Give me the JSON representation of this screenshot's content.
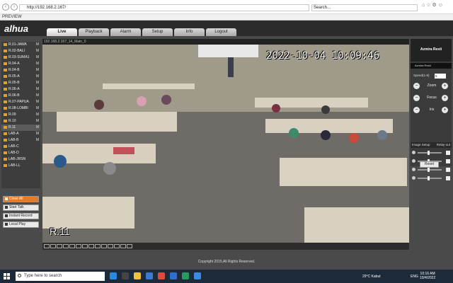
{
  "browser": {
    "url": "http://192.168.2.167/",
    "search_placeholder": "Search...",
    "tab_title": "PREVIEW"
  },
  "app": {
    "logo": "alhua",
    "nav_tabs": [
      "Live",
      "Playback",
      "Alarm",
      "Setup",
      "Info",
      "Logout"
    ],
    "active_tab": "Live"
  },
  "sidebar": {
    "cameras": [
      {
        "label": "R.01-JAWA",
        "flag": "M"
      },
      {
        "label": "R.02-BALI",
        "flag": "M"
      },
      {
        "label": "R.03-SUMA1",
        "flag": "M"
      },
      {
        "label": "R.04-A",
        "flag": "M"
      },
      {
        "label": "R.04-B",
        "flag": "M"
      },
      {
        "label": "R.05-A",
        "flag": "M"
      },
      {
        "label": "R.05-B",
        "flag": "M"
      },
      {
        "label": "R.06-A",
        "flag": "M"
      },
      {
        "label": "R.06-B",
        "flag": "M"
      },
      {
        "label": "R.07-PAPUA",
        "flag": "M"
      },
      {
        "label": "R.08-LOMBI",
        "flag": "M"
      },
      {
        "label": "R.09",
        "flag": "M"
      },
      {
        "label": "R.10",
        "flag": "M"
      },
      {
        "label": "R.11",
        "flag": "M"
      },
      {
        "label": "LAB-A",
        "flag": "M"
      },
      {
        "label": "LAB-B",
        "flag": "M"
      },
      {
        "label": "LAB-C",
        "flag": ""
      },
      {
        "label": "LAB-D",
        "flag": ""
      },
      {
        "label": "LAB-JRSN",
        "flag": ""
      },
      {
        "label": "LAB-LL",
        "flag": ""
      }
    ],
    "buttons": [
      "Close All",
      "Start Talk",
      "Instant Record",
      "Local Play"
    ]
  },
  "video": {
    "channel_label": "192.168.2.167_14_Main_0",
    "osd_time": "2022-10-04 10:09:46",
    "osd_name": "R.11"
  },
  "ptz": {
    "user_name": "Azmira Resti",
    "user_label": "Azmira Resti",
    "speed_label": "Speed(1-8)",
    "speed_value": "5",
    "controls": [
      "Zoom",
      "Focus",
      "Iris"
    ]
  },
  "image_setup": {
    "title": "Image Setup",
    "relay_label": "Relay-out",
    "reset_label": "Reset"
  },
  "footer": {
    "copyright": "Copyright 2015,All Rights Reserved."
  },
  "taskbar": {
    "search_placeholder": "Type here to search",
    "weather": "29°C  Kabut",
    "time": "10:16 AM",
    "date": "10/4/2022",
    "lang": "ENG"
  }
}
